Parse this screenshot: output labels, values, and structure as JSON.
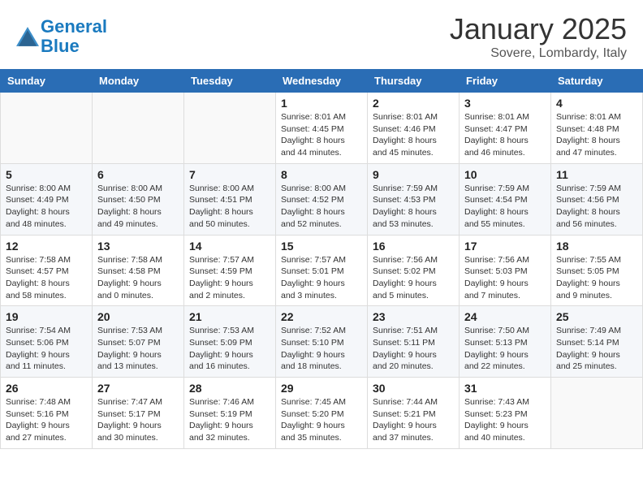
{
  "header": {
    "logo_line1": "General",
    "logo_line2": "Blue",
    "month": "January 2025",
    "location": "Sovere, Lombardy, Italy"
  },
  "weekdays": [
    "Sunday",
    "Monday",
    "Tuesday",
    "Wednesday",
    "Thursday",
    "Friday",
    "Saturday"
  ],
  "weeks": [
    [
      {
        "day": "",
        "info": ""
      },
      {
        "day": "",
        "info": ""
      },
      {
        "day": "",
        "info": ""
      },
      {
        "day": "1",
        "info": "Sunrise: 8:01 AM\nSunset: 4:45 PM\nDaylight: 8 hours\nand 44 minutes."
      },
      {
        "day": "2",
        "info": "Sunrise: 8:01 AM\nSunset: 4:46 PM\nDaylight: 8 hours\nand 45 minutes."
      },
      {
        "day": "3",
        "info": "Sunrise: 8:01 AM\nSunset: 4:47 PM\nDaylight: 8 hours\nand 46 minutes."
      },
      {
        "day": "4",
        "info": "Sunrise: 8:01 AM\nSunset: 4:48 PM\nDaylight: 8 hours\nand 47 minutes."
      }
    ],
    [
      {
        "day": "5",
        "info": "Sunrise: 8:00 AM\nSunset: 4:49 PM\nDaylight: 8 hours\nand 48 minutes."
      },
      {
        "day": "6",
        "info": "Sunrise: 8:00 AM\nSunset: 4:50 PM\nDaylight: 8 hours\nand 49 minutes."
      },
      {
        "day": "7",
        "info": "Sunrise: 8:00 AM\nSunset: 4:51 PM\nDaylight: 8 hours\nand 50 minutes."
      },
      {
        "day": "8",
        "info": "Sunrise: 8:00 AM\nSunset: 4:52 PM\nDaylight: 8 hours\nand 52 minutes."
      },
      {
        "day": "9",
        "info": "Sunrise: 7:59 AM\nSunset: 4:53 PM\nDaylight: 8 hours\nand 53 minutes."
      },
      {
        "day": "10",
        "info": "Sunrise: 7:59 AM\nSunset: 4:54 PM\nDaylight: 8 hours\nand 55 minutes."
      },
      {
        "day": "11",
        "info": "Sunrise: 7:59 AM\nSunset: 4:56 PM\nDaylight: 8 hours\nand 56 minutes."
      }
    ],
    [
      {
        "day": "12",
        "info": "Sunrise: 7:58 AM\nSunset: 4:57 PM\nDaylight: 8 hours\nand 58 minutes."
      },
      {
        "day": "13",
        "info": "Sunrise: 7:58 AM\nSunset: 4:58 PM\nDaylight: 9 hours\nand 0 minutes."
      },
      {
        "day": "14",
        "info": "Sunrise: 7:57 AM\nSunset: 4:59 PM\nDaylight: 9 hours\nand 2 minutes."
      },
      {
        "day": "15",
        "info": "Sunrise: 7:57 AM\nSunset: 5:01 PM\nDaylight: 9 hours\nand 3 minutes."
      },
      {
        "day": "16",
        "info": "Sunrise: 7:56 AM\nSunset: 5:02 PM\nDaylight: 9 hours\nand 5 minutes."
      },
      {
        "day": "17",
        "info": "Sunrise: 7:56 AM\nSunset: 5:03 PM\nDaylight: 9 hours\nand 7 minutes."
      },
      {
        "day": "18",
        "info": "Sunrise: 7:55 AM\nSunset: 5:05 PM\nDaylight: 9 hours\nand 9 minutes."
      }
    ],
    [
      {
        "day": "19",
        "info": "Sunrise: 7:54 AM\nSunset: 5:06 PM\nDaylight: 9 hours\nand 11 minutes."
      },
      {
        "day": "20",
        "info": "Sunrise: 7:53 AM\nSunset: 5:07 PM\nDaylight: 9 hours\nand 13 minutes."
      },
      {
        "day": "21",
        "info": "Sunrise: 7:53 AM\nSunset: 5:09 PM\nDaylight: 9 hours\nand 16 minutes."
      },
      {
        "day": "22",
        "info": "Sunrise: 7:52 AM\nSunset: 5:10 PM\nDaylight: 9 hours\nand 18 minutes."
      },
      {
        "day": "23",
        "info": "Sunrise: 7:51 AM\nSunset: 5:11 PM\nDaylight: 9 hours\nand 20 minutes."
      },
      {
        "day": "24",
        "info": "Sunrise: 7:50 AM\nSunset: 5:13 PM\nDaylight: 9 hours\nand 22 minutes."
      },
      {
        "day": "25",
        "info": "Sunrise: 7:49 AM\nSunset: 5:14 PM\nDaylight: 9 hours\nand 25 minutes."
      }
    ],
    [
      {
        "day": "26",
        "info": "Sunrise: 7:48 AM\nSunset: 5:16 PM\nDaylight: 9 hours\nand 27 minutes."
      },
      {
        "day": "27",
        "info": "Sunrise: 7:47 AM\nSunset: 5:17 PM\nDaylight: 9 hours\nand 30 minutes."
      },
      {
        "day": "28",
        "info": "Sunrise: 7:46 AM\nSunset: 5:19 PM\nDaylight: 9 hours\nand 32 minutes."
      },
      {
        "day": "29",
        "info": "Sunrise: 7:45 AM\nSunset: 5:20 PM\nDaylight: 9 hours\nand 35 minutes."
      },
      {
        "day": "30",
        "info": "Sunrise: 7:44 AM\nSunset: 5:21 PM\nDaylight: 9 hours\nand 37 minutes."
      },
      {
        "day": "31",
        "info": "Sunrise: 7:43 AM\nSunset: 5:23 PM\nDaylight: 9 hours\nand 40 minutes."
      },
      {
        "day": "",
        "info": ""
      }
    ]
  ]
}
